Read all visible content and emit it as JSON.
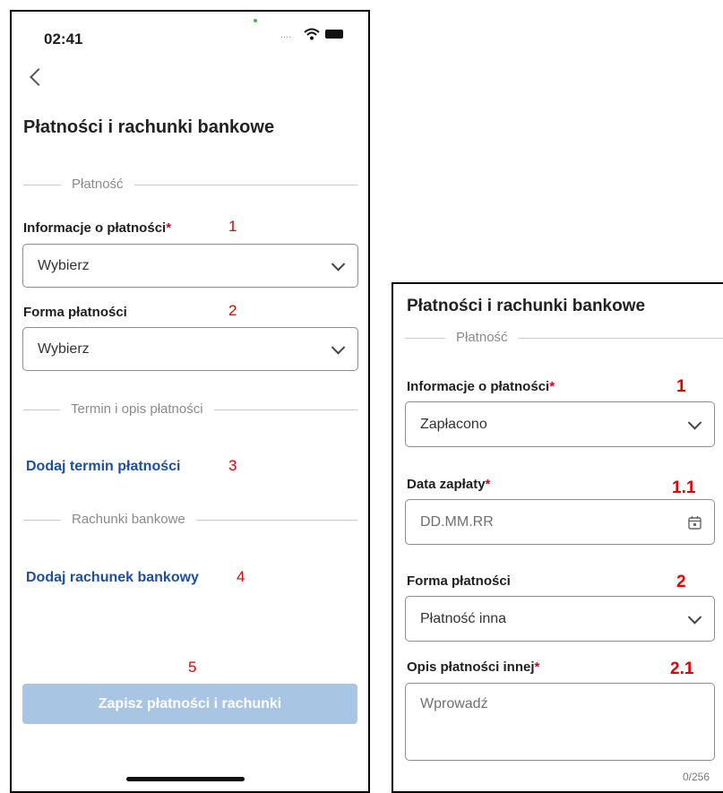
{
  "phone_a": {
    "status_time": "02:41",
    "page_title": "Płatności i rachunki bankowe",
    "section_payment": "Płatność",
    "payment_info_label": "Informacje o płatności",
    "required_mark": "*",
    "payment_info_value": "Wybierz",
    "payment_form_label": "Forma płatności",
    "payment_form_value": "Wybierz",
    "section_term": "Termin i opis płatności",
    "add_term_link": "Dodaj termin płatności",
    "section_accounts": "Rachunki bankowe",
    "add_account_link": "Dodaj rachunek bankowy",
    "save_button": "Zapisz płatności i rachunki",
    "markers": [
      "1",
      "2",
      "3",
      "4",
      "5"
    ]
  },
  "phone_b": {
    "page_title": "Płatności i rachunki bankowe",
    "section_payment": "Płatność",
    "payment_info_label": "Informacje o płatności",
    "required_mark": "*",
    "payment_info_value": "Zapłacono",
    "payment_date_label": "Data zapłaty",
    "payment_date_placeholder": "DD.MM.RR",
    "payment_form_label": "Forma płatności",
    "payment_form_value": "Płatność inna",
    "other_desc_label": "Opis płatności innej",
    "other_desc_placeholder": "Wprowadź",
    "char_counter": "0/256",
    "markers": [
      "1",
      "1.1",
      "2",
      "2.1"
    ]
  },
  "colors": {
    "accent_link": "#1d4f9c",
    "required": "#d0021b",
    "marker": "#e00000",
    "button_disabled": "#a8c6e3"
  },
  "icons": [
    "back-chevron-icon",
    "wifi-icon",
    "battery-icon",
    "chevron-down-icon",
    "calendar-icon"
  ]
}
